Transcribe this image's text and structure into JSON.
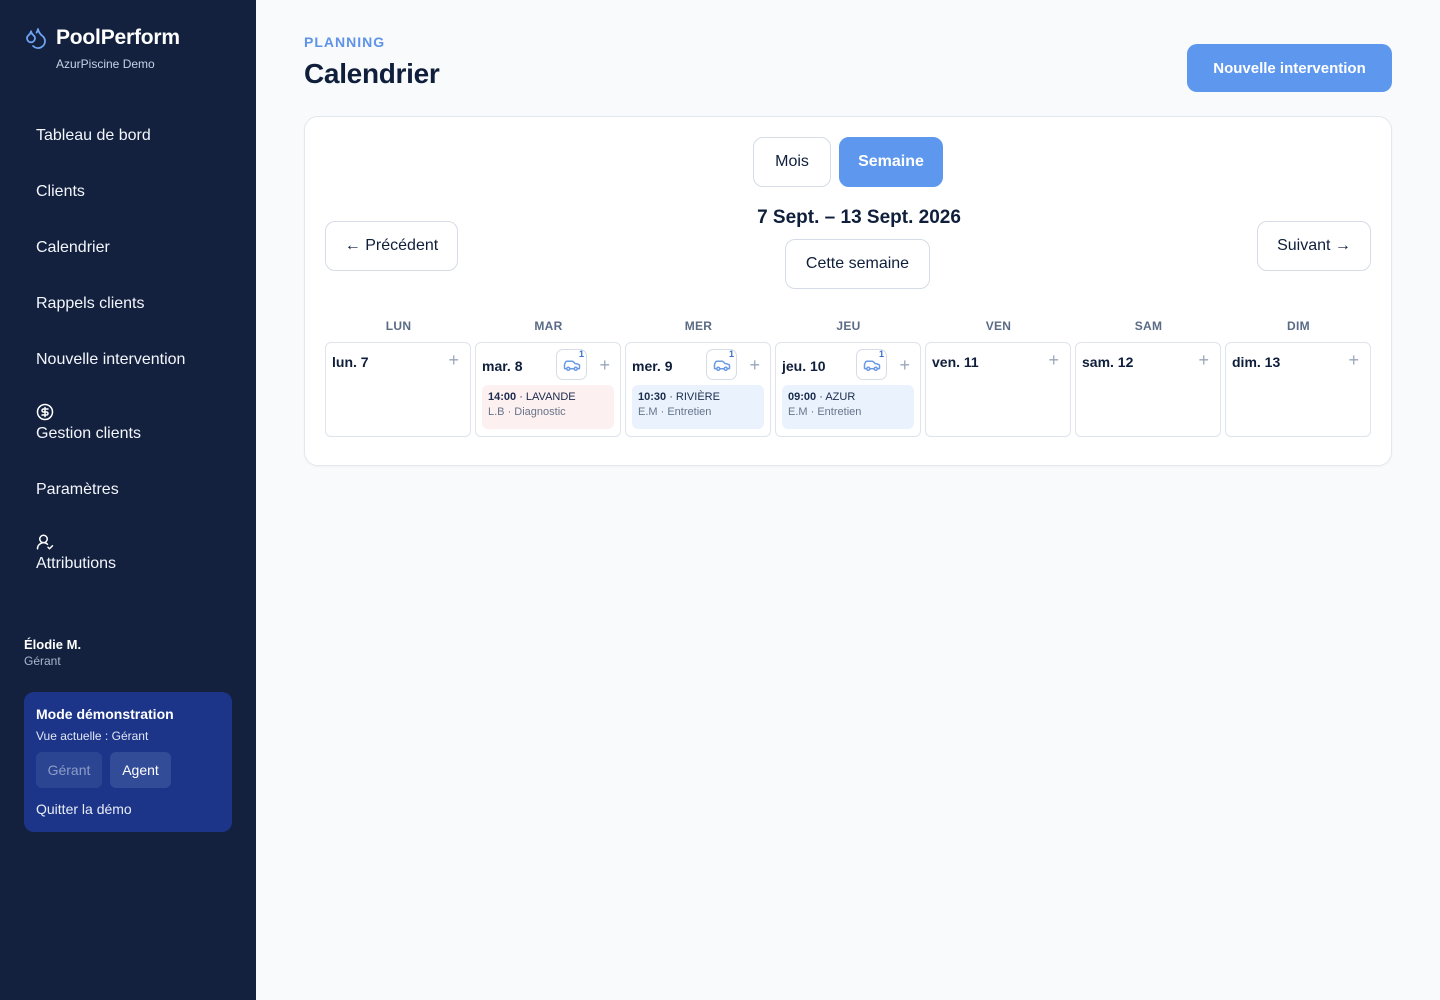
{
  "app": {
    "name": "PoolPerform",
    "org": "AzurPiscine Demo"
  },
  "sidebar": {
    "items": [
      {
        "label": "Tableau de bord"
      },
      {
        "label": "Clients"
      },
      {
        "label": "Calendrier"
      },
      {
        "label": "Rappels clients"
      },
      {
        "label": "Nouvelle intervention"
      },
      {
        "label": "Gestion clients",
        "icon": "dollar-circle-icon"
      },
      {
        "label": "Paramètres"
      },
      {
        "label": "Attributions",
        "icon": "user-check-icon"
      }
    ],
    "user": {
      "name": "Élodie M.",
      "role": "Gérant"
    },
    "demo": {
      "title": "Mode démonstration",
      "subtitle": "Vue actuelle : Gérant",
      "gerant_label": "Gérant",
      "agent_label": "Agent",
      "quit_label": "Quitter la démo"
    }
  },
  "header": {
    "eyebrow": "PLANNING",
    "title": "Calendrier",
    "primary_button": "Nouvelle intervention"
  },
  "calendar": {
    "view_tabs": [
      {
        "label": "Mois",
        "active": false
      },
      {
        "label": "Semaine",
        "active": true
      }
    ],
    "range_label": "7 Sept. – 13 Sept. 2026",
    "prev_label": "← Précédent",
    "next_label": "Suivant →",
    "today_label": "Cette semaine",
    "weekday_headers": [
      "LUN",
      "MAR",
      "MER",
      "JEU",
      "VEN",
      "SAM",
      "DIM"
    ],
    "plus_symbol": "+",
    "days": [
      {
        "label": "lun. 7"
      },
      {
        "label": "mar. 8",
        "vehicle_count": "1",
        "event": {
          "time": "14:00",
          "client": "LAVANDE",
          "agent": "L.B",
          "type": "Diagnostic",
          "color": "red"
        }
      },
      {
        "label": "mer. 9",
        "vehicle_count": "1",
        "event": {
          "time": "10:30",
          "client": "RIVIÈRE",
          "agent": "E.M",
          "type": "Entretien",
          "color": "blue"
        }
      },
      {
        "label": "jeu. 10",
        "vehicle_count": "1",
        "event": {
          "time": "09:00",
          "client": "AZUR",
          "agent": "E.M",
          "type": "Entretien",
          "color": "blue"
        }
      },
      {
        "label": "ven. 11"
      },
      {
        "label": "sam. 12"
      },
      {
        "label": "dim. 13"
      }
    ]
  },
  "colors": {
    "sidebar_bg": "#13213f",
    "accent": "#5e97ee",
    "demo_bg": "#1d3588",
    "event_red_bg": "#fdf0f0",
    "event_blue_bg": "#eaf2fd"
  }
}
